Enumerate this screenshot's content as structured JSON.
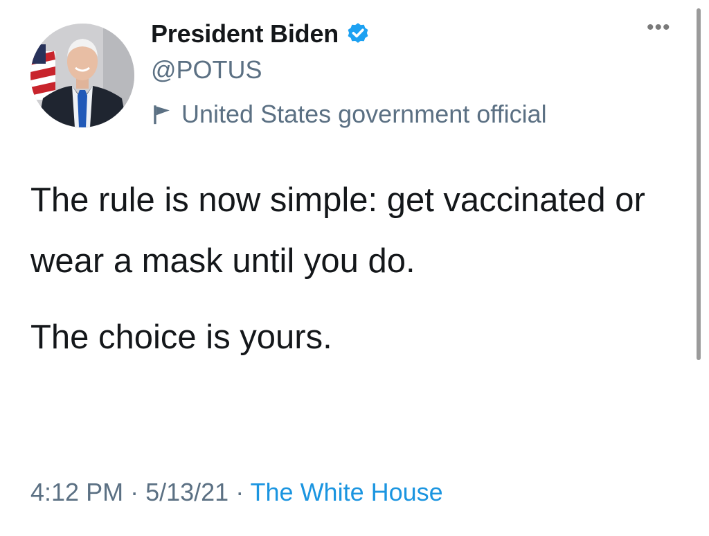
{
  "author": {
    "name": "President Biden",
    "handle": "@POTUS",
    "label": "United States government official",
    "verified": true
  },
  "tweet": {
    "paragraphs": [
      "The rule is now simple: get vaccinated or wear a mask until you do.",
      "The choice is yours."
    ]
  },
  "meta": {
    "time": "4:12 PM",
    "separator": " · ",
    "date": "5/13/21",
    "source": "The White House"
  },
  "icons": {
    "verified": "verified-badge-icon",
    "label": "flag-icon",
    "menu": "more-options-icon"
  },
  "colors": {
    "primary_text": "#14171a",
    "secondary_text": "#5b7083",
    "link": "#1b95e0",
    "verified": "#1da1f2"
  }
}
